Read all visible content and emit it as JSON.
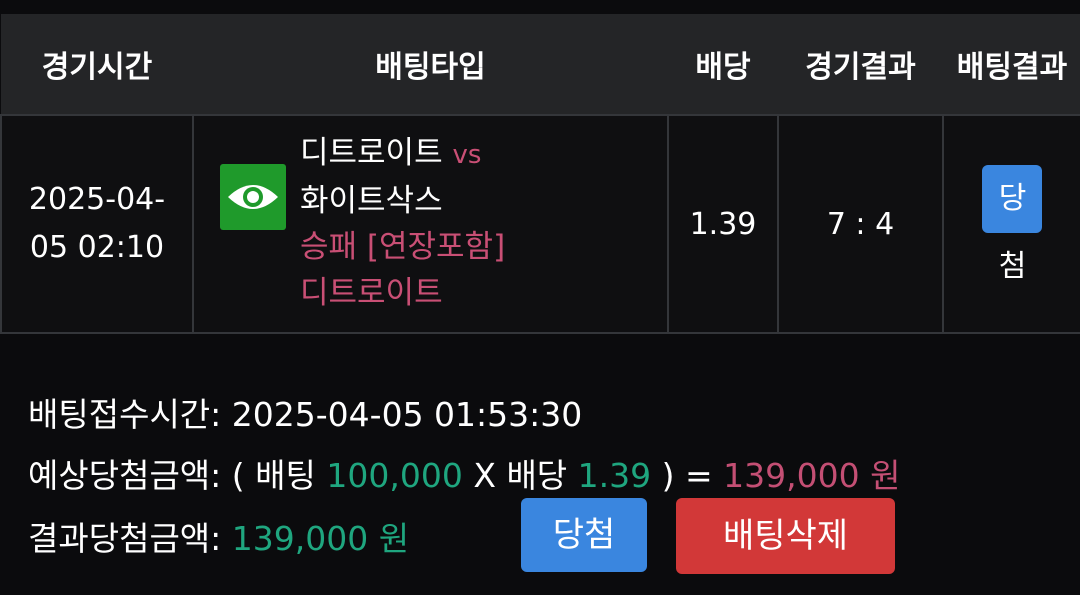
{
  "header": {
    "col_time": "경기시간",
    "col_type": "배팅타입",
    "col_odds": "배당",
    "col_game_result": "경기결과",
    "col_bet_result": "배팅결과"
  },
  "row": {
    "time_date": "2025-04-",
    "time_rest": "05 02:10",
    "icon": "eye-icon",
    "home_team": "디트로이트",
    "vs": "vs",
    "away_team": "화이트삭스",
    "market": "승패 [연장포함]",
    "pick": "디트로이트",
    "odds": "1.39",
    "score": "7 : 4",
    "result_badge": "당첨"
  },
  "summary": {
    "accept_label": "배팅접수시간:",
    "accept_value": "2025-04-05 01:53:30",
    "expected_label": "예상당첨금액:",
    "expected_open": "( 배팅",
    "bet_amount": "100,000",
    "expected_mid": "X 배당",
    "expected_odds": "1.39",
    "expected_close": ") =",
    "expected_total": "139,000 원",
    "final_label": "결과당첨금액:",
    "final_value": "139,000 원"
  },
  "buttons": {
    "win_label": "당첨",
    "delete_label": "배팅삭제"
  },
  "colors": {
    "header_bg": "#242527",
    "pink": "#c94f75",
    "green": "#1fa67f",
    "blue": "#3a86df",
    "red": "#d23838",
    "icon_green": "#1f9a2b"
  }
}
